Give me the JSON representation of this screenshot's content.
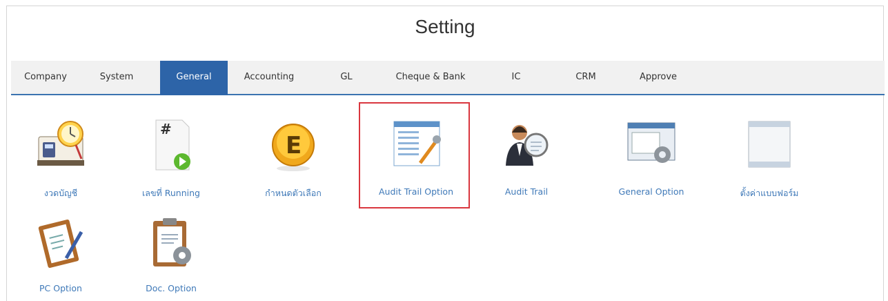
{
  "page": {
    "title": "Setting"
  },
  "tabs": [
    "Company",
    "System",
    "General",
    "Accounting",
    "GL",
    "Cheque & Bank",
    "IC",
    "CRM",
    "Approve"
  ],
  "active_tab": "General",
  "items": [
    {
      "label": "งวดบัญชี",
      "icon": "calendar-clock-icon"
    },
    {
      "label": "เลขที่ Running",
      "icon": "running-number-icon"
    },
    {
      "label": "กำหนดตัวเลือก",
      "icon": "option-e-icon"
    },
    {
      "label": "Audit Trail Option",
      "icon": "audit-trail-option-icon"
    },
    {
      "label": "Audit Trail",
      "icon": "audit-user-search-icon"
    },
    {
      "label": "General Option",
      "icon": "window-gear-icon"
    },
    {
      "label": "ตั้งค่าแบบฟอร์ม",
      "icon": "form-window-icon"
    },
    {
      "label": "PC Option",
      "icon": "clipboard-pen-icon"
    },
    {
      "label": "Doc. Option",
      "icon": "clipboard-gear-icon"
    }
  ],
  "highlighted_item": "Audit Trail Option",
  "colors": {
    "accent": "#2d64a8",
    "label": "#3f79b8",
    "highlight": "#d9363e"
  }
}
